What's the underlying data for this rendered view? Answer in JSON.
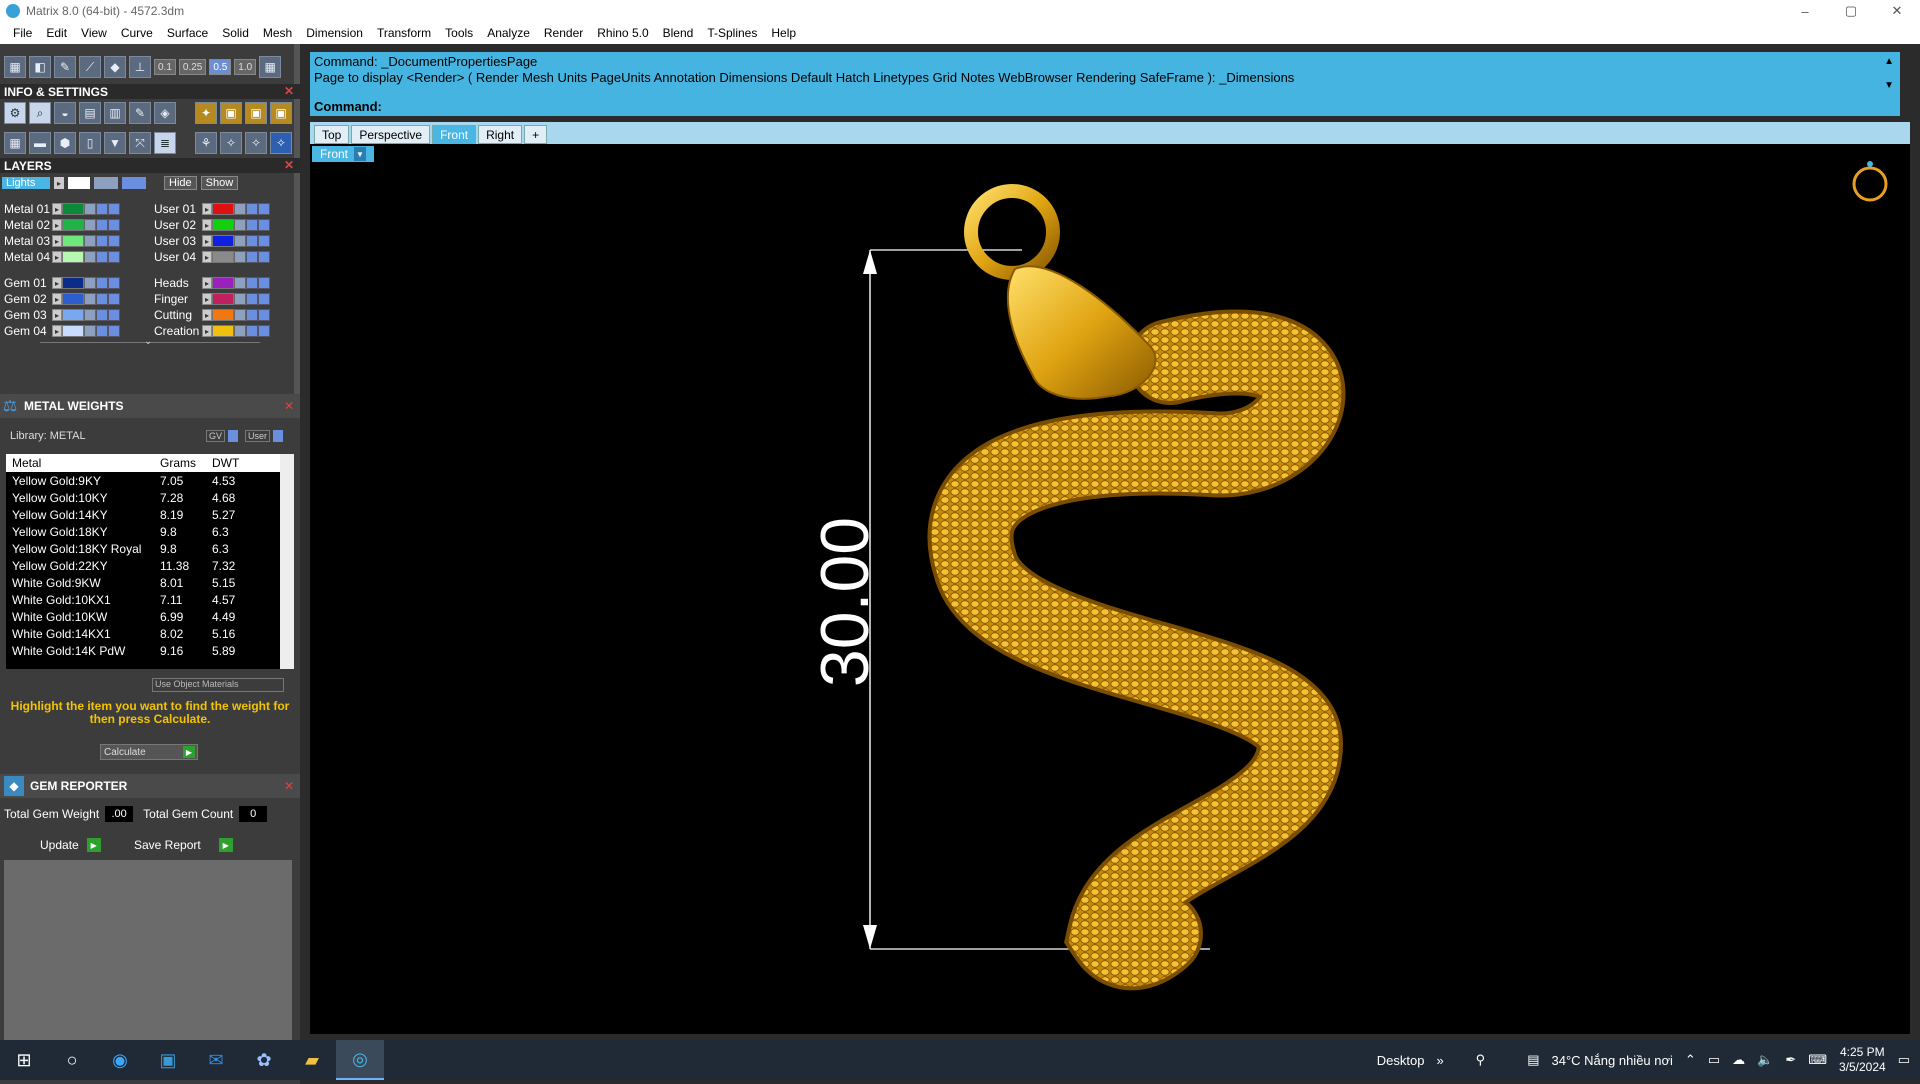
{
  "window": {
    "title": "Matrix 8.0 (64-bit) - 4572.3dm",
    "controls": [
      "–",
      "▢",
      "✕"
    ]
  },
  "menu": [
    "File",
    "Edit",
    "View",
    "Curve",
    "Surface",
    "Solid",
    "Mesh",
    "Dimension",
    "Transform",
    "Tools",
    "Analyze",
    "Render",
    "Rhino 5.0",
    "Blend",
    "T-Splines",
    "Help"
  ],
  "toolbar": {
    "values": [
      "0.1",
      "0.25",
      "0.5",
      "1.0"
    ]
  },
  "info_settings": {
    "title": "INFO & SETTINGS"
  },
  "layers": {
    "title": "LAYERS",
    "lights_label": "Lights",
    "hide_label": "Hide",
    "show_label": "Show",
    "left": [
      {
        "name": "Metal 01",
        "color": "#0a8a3a"
      },
      {
        "name": "Metal 02",
        "color": "#22b24a"
      },
      {
        "name": "Metal 03",
        "color": "#6ee87a"
      },
      {
        "name": "Metal 04",
        "color": "#b8f7b0"
      },
      {
        "name": "Gem 01",
        "color": "#0c2c8c"
      },
      {
        "name": "Gem 02",
        "color": "#2c5ed0"
      },
      {
        "name": "Gem 03",
        "color": "#7aa8f0"
      },
      {
        "name": "Gem 04",
        "color": "#c8dcff"
      }
    ],
    "right": [
      {
        "name": "User 01",
        "color": "#e01010"
      },
      {
        "name": "User 02",
        "color": "#10d010"
      },
      {
        "name": "User 03",
        "color": "#1020e0"
      },
      {
        "name": "User 04",
        "color": "#8a8a8a"
      },
      {
        "name": "Heads",
        "color": "#9a20c0"
      },
      {
        "name": "Finger",
        "color": "#c02060"
      },
      {
        "name": "Cutting",
        "color": "#f07810"
      },
      {
        "name": "Creation",
        "color": "#f0c010"
      }
    ]
  },
  "metal_weights": {
    "title": "METAL WEIGHTS",
    "library": "Library: METAL",
    "gv_label": "GV",
    "user_label": "User",
    "headers": [
      "Metal",
      "Grams",
      "DWT"
    ],
    "rows": [
      [
        "Yellow Gold:9KY",
        "7.05",
        "4.53"
      ],
      [
        "Yellow Gold:10KY",
        "7.28",
        "4.68"
      ],
      [
        "Yellow Gold:14KY",
        "8.19",
        "5.27"
      ],
      [
        "Yellow Gold:18KY",
        "9.8",
        "6.3"
      ],
      [
        "Yellow Gold:18KY Royal",
        "9.8",
        "6.3"
      ],
      [
        "Yellow Gold:22KY",
        "11.38",
        "7.32"
      ],
      [
        "White Gold:9KW",
        "8.01",
        "5.15"
      ],
      [
        "White Gold:10KX1",
        "7.11",
        "4.57"
      ],
      [
        "White Gold:10KW",
        "6.99",
        "4.49"
      ],
      [
        "White Gold:14KX1",
        "8.02",
        "5.16"
      ],
      [
        "White Gold:14K PdW",
        "9.16",
        "5.89"
      ]
    ],
    "use_object_materials": "Use Object Materials",
    "hint": "Highlight the item you want to find the weight for then press Calculate.",
    "calculate": "Calculate"
  },
  "gem_reporter": {
    "title": "GEM REPORTER",
    "total_weight_label": "Total Gem Weight",
    "total_weight": ".00",
    "total_count_label": "Total Gem Count",
    "total_count": "0",
    "update": "Update",
    "save_report": "Save Report"
  },
  "command": {
    "line1": "Command: _DocumentPropertiesPage",
    "line2": "Page to display <Render> ( Render  Mesh  Units  PageUnits  Annotation  Dimensions  Default  Hatch  Linetypes  Grid  Notes  WebBrowser  Rendering  SafeFrame ): _Dimensions",
    "prompt": "Command:"
  },
  "viewport_tabs": [
    "Top",
    "Perspective",
    "Front",
    "Right",
    "+"
  ],
  "viewport": {
    "label": "Front",
    "dimension": "30.00"
  },
  "taskbar": {
    "desktop": "Desktop",
    "weather": "34°C  Nắng nhiều nơi",
    "time": "4:25 PM",
    "date": "3/5/2024"
  }
}
